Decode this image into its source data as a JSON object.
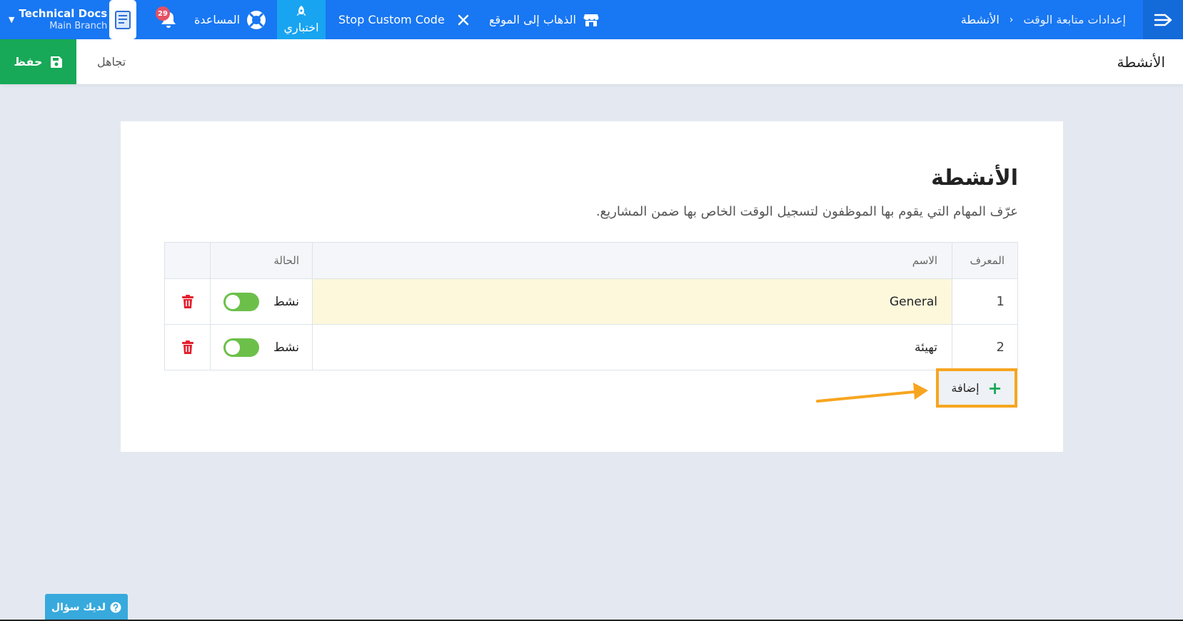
{
  "topbar": {
    "breadcrumb": [
      "إعدادات متابعة الوقت",
      "الأنشطة"
    ],
    "goto_site": "الذهاب إلى الموقع",
    "stop_code": "Stop Custom Code",
    "test_mode": "اختباري",
    "help": "المساعدة",
    "notifications_count": "29",
    "account_name": "Technical Docs",
    "account_branch": "Main Branch"
  },
  "subheader": {
    "title": "الأنشطة",
    "ignore_label": "تجاهل",
    "save_label": "حفظ"
  },
  "card": {
    "title": "الأنشطة",
    "description": "عرّف المهام التي يقوم بها الموظفون لتسجيل الوقت الخاص بها ضمن المشاريع.",
    "columns": {
      "id": "المعرف",
      "name": "الاسم",
      "status": "الحالة"
    },
    "rows": [
      {
        "id": "1",
        "name": "General",
        "status": "نشط"
      },
      {
        "id": "2",
        "name": "تهيئة",
        "status": "نشط"
      }
    ],
    "add_label": "إضافة"
  },
  "help_widget": {
    "label": "لديك سؤال"
  },
  "colors": {
    "navbar": "#1877f2",
    "test_mode": "#18a4f0",
    "save": "#17a957",
    "toggle_on": "#6cc04a",
    "delete": "#e5202e",
    "highlight": "#f7a520",
    "background": "#e4e9f1"
  }
}
